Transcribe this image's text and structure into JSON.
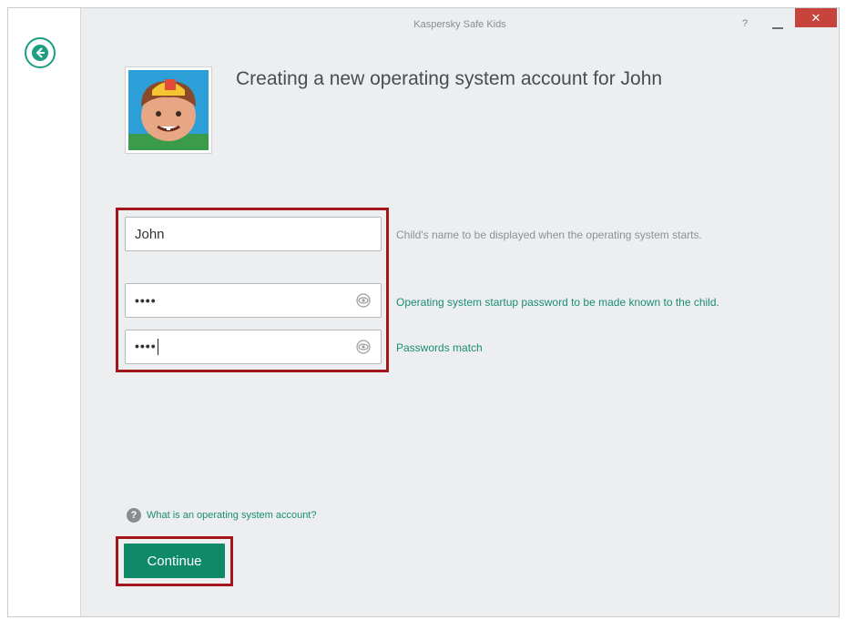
{
  "window": {
    "title": "Kaspersky Safe Kids",
    "help_label": "?",
    "close_label": "✕"
  },
  "page": {
    "title": "Creating a new operating system account for John"
  },
  "form": {
    "name_value": "John",
    "name_hint": "Child's name to be displayed when the operating system starts.",
    "password_value": "••••",
    "password_hint": "Operating system startup password to be made known to the child.",
    "confirm_value": "••••",
    "confirm_hint": "Passwords match"
  },
  "help_link": {
    "icon_label": "?",
    "text": "What is an operating system account?"
  },
  "actions": {
    "continue_label": "Continue"
  },
  "colors": {
    "accent": "#0f8a69",
    "highlight": "#a2151b",
    "close": "#c7443c"
  },
  "icons": {
    "back": "back-arrow-icon",
    "eye": "eye-icon",
    "help": "question-icon"
  }
}
